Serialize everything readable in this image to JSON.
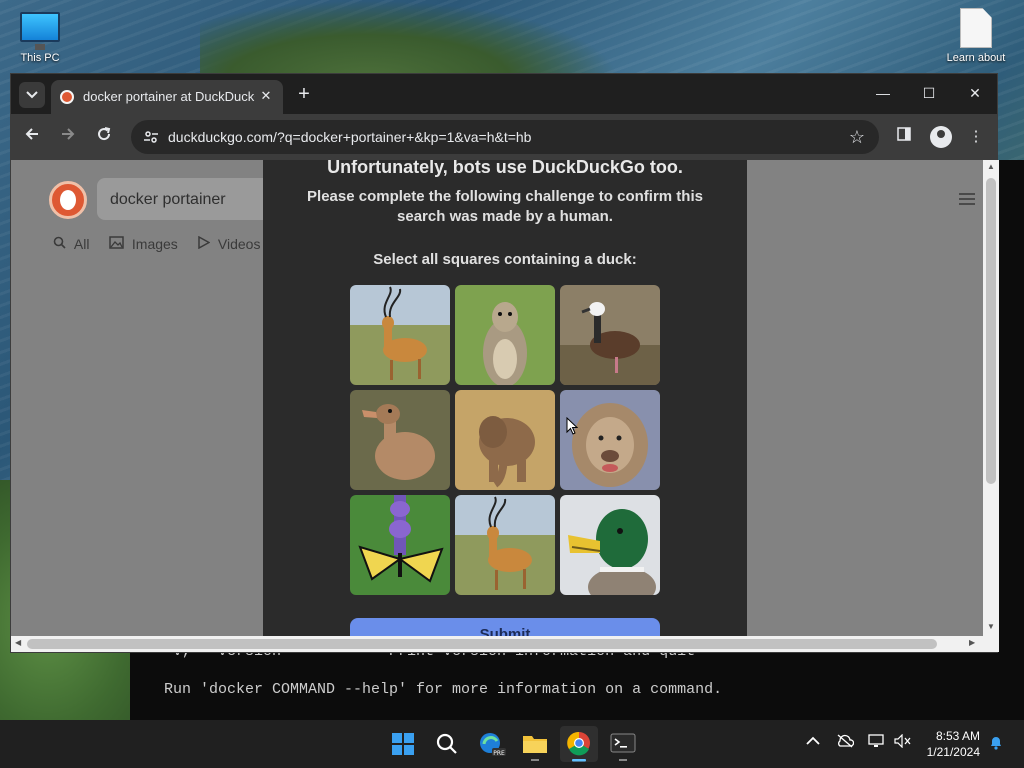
{
  "desktop": {
    "icons": [
      {
        "label": "This PC"
      },
      {
        "label": "Learn about"
      }
    ]
  },
  "terminal": {
    "lines": [
      "-v, --version            Print version information and quit",
      "Run 'docker COMMAND --help' for more information on a command."
    ]
  },
  "browser": {
    "tab_title": "docker portainer at DuckDuckGo",
    "tab_close": "✕",
    "new_tab": "+",
    "url": "duckduckgo.com/?q=docker+portainer+&kp=1&va=h&t=hb",
    "window_controls": {
      "minimize": "—",
      "maximize": "☐",
      "close": "✕"
    }
  },
  "page": {
    "search_query": "docker portainer",
    "search_tabs": [
      {
        "icon": "search-icon",
        "label": "All"
      },
      {
        "icon": "image-icon",
        "label": "Images"
      },
      {
        "icon": "video-icon",
        "label": "Videos"
      }
    ]
  },
  "challenge": {
    "heading": "Unfortunately, bots use DuckDuckGo too.",
    "subtitle": "Please complete the following challenge to confirm this search was made by a human.",
    "prompt": "Select all squares containing a duck:",
    "tiles": [
      {
        "subject": "antelope"
      },
      {
        "subject": "ground squirrel"
      },
      {
        "subject": "whistling duck"
      },
      {
        "subject": "brown duck"
      },
      {
        "subject": "baby elephant"
      },
      {
        "subject": "lion"
      },
      {
        "subject": "butterfly on lupine"
      },
      {
        "subject": "antelope"
      },
      {
        "subject": "mallard duck"
      }
    ],
    "submit_label": "Submit"
  },
  "taskbar": {
    "apps": [
      "start-icon",
      "search-icon",
      "edge-preview-icon",
      "file-explorer-icon",
      "chrome-icon",
      "terminal-icon"
    ],
    "time": "8:53 AM",
    "date": "1/21/2024"
  }
}
